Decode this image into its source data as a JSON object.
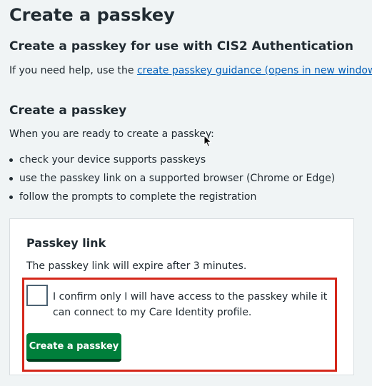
{
  "page": {
    "title": "Create a passkey",
    "subtitle": "Create a passkey for use with CIS2 Authentication",
    "help_prefix": "If you need help, use the ",
    "help_link": "create passkey guidance (opens in new window)",
    "help_suffix": "."
  },
  "section": {
    "heading": "Create a passkey",
    "intro": "When you are ready to create a passkey:",
    "steps": [
      "check your device supports passkeys",
      "use the passkey link on a supported browser (Chrome or Edge)",
      "follow the prompts to complete the registration"
    ]
  },
  "card": {
    "heading": "Passkey link",
    "expiry": "The passkey link will expire after 3 minutes.",
    "confirm_label": "I confirm only I will have access to the passkey while it can connect to my Care Identity profile.",
    "confirm_checked": false,
    "button_label": "Create a passkey"
  },
  "colors": {
    "background": "#f0f4f5",
    "link": "#005eb8",
    "button": "#007f3b",
    "highlight": "#d5281b"
  }
}
